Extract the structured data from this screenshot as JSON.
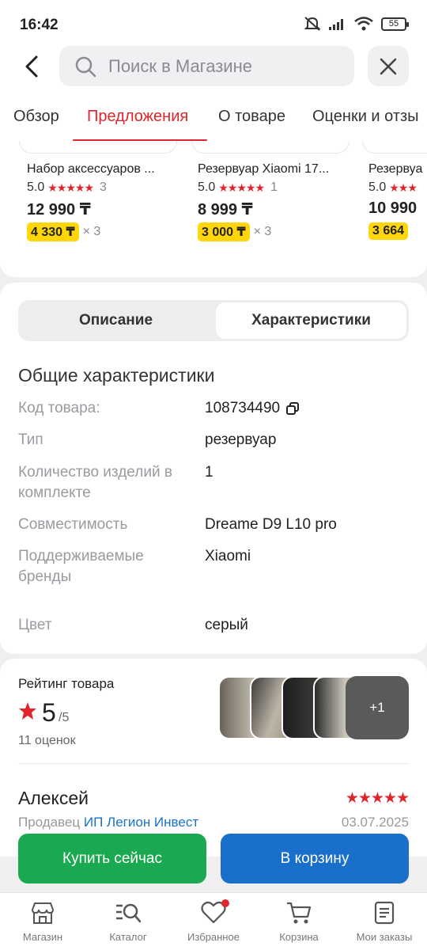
{
  "status": {
    "time": "16:42",
    "battery": "55"
  },
  "search": {
    "placeholder": "Поиск в Магазине"
  },
  "tabs": [
    {
      "label": "Обзор"
    },
    {
      "label": "Предложения"
    },
    {
      "label": "О товаре"
    },
    {
      "label": "Оценки и отзы"
    }
  ],
  "products": [
    {
      "name": "Набор аксессуаров ...",
      "rating": "5.0",
      "stars": "★★★★★",
      "count": "3",
      "price": "12 990 ₸",
      "installment": "4 330 ₸",
      "multiplier": "× 3"
    },
    {
      "name": "Резервуар Xiaomi 17...",
      "rating": "5.0",
      "stars": "★★★★★",
      "count": "1",
      "price": "8 999 ₸",
      "installment": "3 000 ₸",
      "multiplier": "× 3"
    },
    {
      "name": "Резервуа",
      "rating": "5.0",
      "stars": "★★★",
      "count": "",
      "price": "10 990",
      "installment": "3 664",
      "multiplier": ""
    }
  ],
  "segment": {
    "description": "Описание",
    "specs": "Характеристики"
  },
  "specs": {
    "title": "Общие характеристики",
    "rows": [
      {
        "key": "Код товара:",
        "value": "108734490"
      },
      {
        "key": "Тип",
        "value": "резервуар"
      },
      {
        "key": "Количество изделий в комплекте",
        "value": "1"
      },
      {
        "key": "Совместимость",
        "value": "Dreame D9 L10 pro"
      },
      {
        "key": "Поддерживаемые бренды",
        "value": "Xiaomi"
      },
      {
        "key": "Цвет",
        "value": "серый"
      }
    ]
  },
  "rating": {
    "label": "Рейтинг товара",
    "value": "5",
    "of": "/5",
    "count": "11 оценок",
    "more_photos": "+1"
  },
  "review": {
    "author": "Алексей",
    "stars": "★★★★★",
    "seller_prefix": "Продавец ",
    "seller_name": "ИП Легион Инвест",
    "date": "03.07.2025"
  },
  "buttons": {
    "buy": "Купить сейчас",
    "cart": "В корзину"
  },
  "nav": [
    {
      "label": "Магазин"
    },
    {
      "label": "Каталог"
    },
    {
      "label": "Избранное"
    },
    {
      "label": "Корзина"
    },
    {
      "label": "Мои заказы"
    }
  ],
  "colors": {
    "accent": "#e1252c",
    "buy": "#1aa951",
    "cart": "#1a6fcb",
    "installment": "#ffd60a"
  }
}
